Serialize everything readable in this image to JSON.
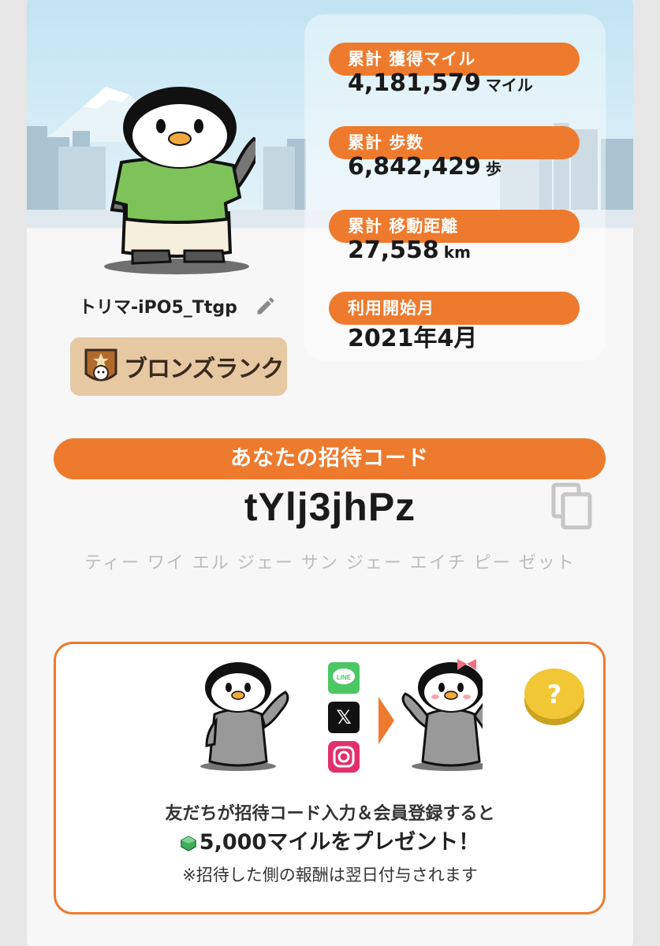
{
  "profile": {
    "username": "トリマ-iPO5_Ttgp",
    "rank_label": "ブロンズランク",
    "edit_icon": "pencil-icon"
  },
  "stats": [
    {
      "label": "累計 獲得マイル",
      "value": "4,181,579",
      "unit": "マイル"
    },
    {
      "label": "累計 歩数",
      "value": "6,842,429",
      "unit": "歩"
    },
    {
      "label": "累計 移動距離",
      "value": "27,558",
      "unit": "km"
    },
    {
      "label": "利用開始月",
      "value": "2021年4月",
      "unit": ""
    }
  ],
  "invite": {
    "title": "あなたの招待コード",
    "code": "tYlj3jhPz",
    "reading": "ティー ワイ エル ジェー サン ジェー エイチ ピー ゼット",
    "copy_icon": "copy-icon"
  },
  "promo": {
    "line1": "友だちが招待コード入力＆会員登録すると",
    "line2": "5,000マイルをプレゼント！",
    "note": "※招待した側の報酬は翌日付与されます",
    "help_label": "?",
    "share_icons": [
      "line-icon",
      "x-icon",
      "instagram-icon"
    ]
  },
  "colors": {
    "accent": "#ee7a2e",
    "rank_bg": "#e6c8a3",
    "sky": "#c7e6f3"
  }
}
